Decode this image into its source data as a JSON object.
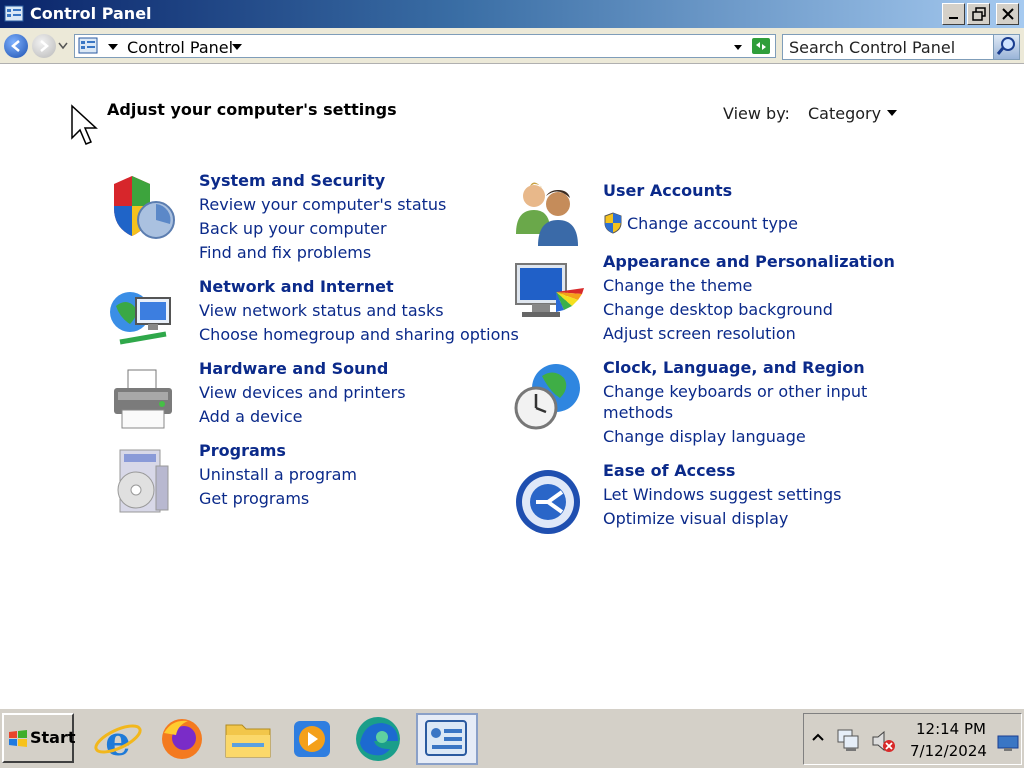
{
  "window": {
    "title": "Control Panel"
  },
  "address": {
    "path_label": "Control Panel",
    "search_placeholder": "Search Control Panel"
  },
  "main": {
    "title": "Adjust your computer's settings",
    "view_by_label": "View by:",
    "view_by_value": "Category"
  },
  "categories": [
    {
      "title": "System and Security",
      "links": [
        "Review your computer's status",
        "Back up your computer",
        "Find and fix problems"
      ]
    },
    {
      "title": "Network and Internet",
      "links": [
        "View network status and tasks",
        "Choose homegroup and sharing options"
      ]
    },
    {
      "title": "Hardware and Sound",
      "links": [
        "View devices and printers",
        "Add a device"
      ]
    },
    {
      "title": "Programs",
      "links": [
        "Uninstall a program",
        "Get programs"
      ]
    },
    {
      "title": "User Accounts",
      "links": [
        "Change account type"
      ]
    },
    {
      "title": "Appearance and Personalization",
      "links": [
        "Change the theme",
        "Change desktop background",
        "Adjust screen resolution"
      ]
    },
    {
      "title": "Clock, Language, and Region",
      "links": [
        "Change keyboards or other input",
        "methods",
        "Change display language"
      ]
    },
    {
      "title": "Ease of Access",
      "links": [
        "Let Windows suggest settings",
        "Optimize visual display"
      ]
    }
  ],
  "taskbar": {
    "start_label": "Start",
    "apps": [
      "internet-explorer-icon",
      "firefox-icon",
      "file-explorer-icon",
      "media-player-icon",
      "edge-icon",
      "control-panel-icon"
    ],
    "clock_time": "12:14 PM",
    "clock_date": "7/12/2024"
  },
  "colors": {
    "link": "#0b2a8a",
    "titlebar_start": "#0a246a",
    "titlebar_end": "#a6caf0",
    "taskbar": "#d4d0c8"
  }
}
